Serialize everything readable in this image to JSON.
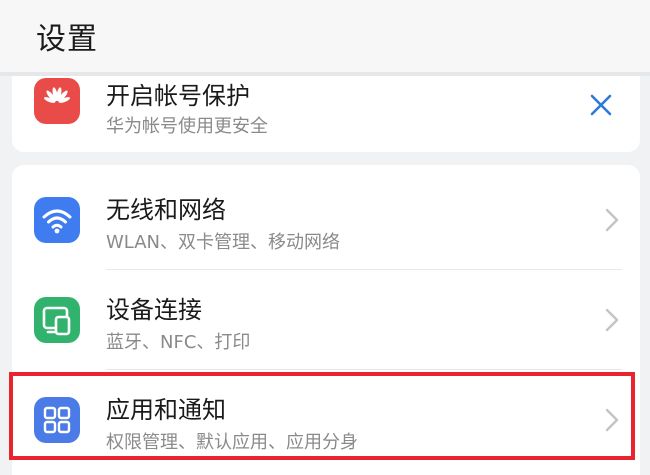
{
  "header": {
    "title": "设置"
  },
  "promo": {
    "title": "开启帐号保护",
    "subtitle": "华为帐号使用更安全",
    "icon": "huawei-logo-icon",
    "close_icon": "close-icon",
    "icon_color": "#e94c48",
    "close_color": "#2d7ad6"
  },
  "items": [
    {
      "title": "无线和网络",
      "subtitle": "WLAN、双卡管理、移动网络",
      "icon": "wifi-icon",
      "icon_color": "#3f7cf0"
    },
    {
      "title": "设备连接",
      "subtitle": "蓝牙、NFC、打印",
      "icon": "device-connection-icon",
      "icon_color": "#32b36d"
    },
    {
      "title": "应用和通知",
      "subtitle": "权限管理、默认应用、应用分身",
      "icon": "apps-icon",
      "icon_color": "#4a7be6",
      "highlighted": true
    }
  ],
  "colors": {
    "background": "#f1f2f4",
    "highlight_border": "#e8242c",
    "chevron": "#c4c4c4"
  }
}
